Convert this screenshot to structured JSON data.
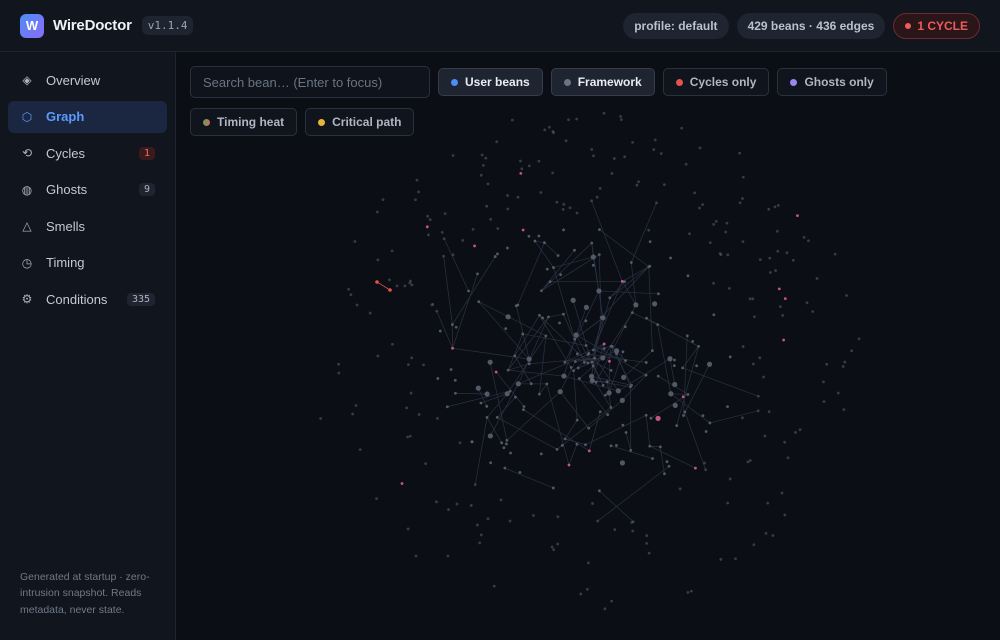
{
  "app": {
    "logo_letter": "W",
    "name": "WireDoctor",
    "version": "v1.1.4"
  },
  "header": {
    "profile": "profile: default",
    "stats": "429 beans · 436 edges",
    "cycle_badge": "1 CYCLE"
  },
  "sidebar": {
    "items": [
      {
        "label": "Overview",
        "icon": "diamond-icon",
        "glyph": "◈",
        "count": ""
      },
      {
        "label": "Graph",
        "icon": "hexagon-icon",
        "glyph": "⬡",
        "count": ""
      },
      {
        "label": "Cycles",
        "icon": "cycle-icon",
        "glyph": "⟲",
        "count": "1"
      },
      {
        "label": "Ghosts",
        "icon": "ghost-icon",
        "glyph": "◍",
        "count": "9"
      },
      {
        "label": "Smells",
        "icon": "warning-icon",
        "glyph": "△",
        "count": ""
      },
      {
        "label": "Timing",
        "icon": "clock-icon",
        "glyph": "◷",
        "count": ""
      },
      {
        "label": "Conditions",
        "icon": "gear-icon",
        "glyph": "⚙",
        "count": "335"
      }
    ],
    "footer": "Generated at startup · zero-intrusion snapshot. Reads metadata, never state."
  },
  "toolbar": {
    "search_placeholder": "Search bean… (Enter to focus)",
    "filters": [
      {
        "label": "User beans",
        "color": "#4c8df6",
        "active": true
      },
      {
        "label": "Framework",
        "color": "#6b7385",
        "active": true
      },
      {
        "label": "Cycles only",
        "color": "#e5534b",
        "active": false
      },
      {
        "label": "Ghosts only",
        "color": "#9b86f0",
        "active": false
      },
      {
        "label": "Timing heat",
        "color": "#c97a5a",
        "active": false
      },
      {
        "label": "Critical path",
        "color": "#e8b53a",
        "active": false
      }
    ]
  },
  "colors": {
    "accent": "#5b9bff",
    "node": "#59626f",
    "highlight_node": "#e45fa0",
    "cycle_node": "#e5534b",
    "edge": "#2a3242"
  }
}
